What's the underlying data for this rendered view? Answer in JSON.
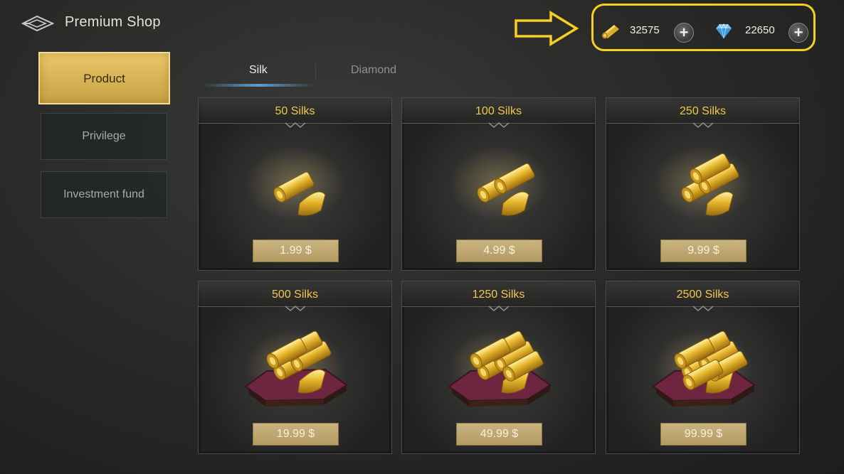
{
  "header": {
    "title": "Premium Shop"
  },
  "currencies": [
    {
      "icon": "silk-roll-icon",
      "value": "32575"
    },
    {
      "icon": "diamond-icon",
      "value": "22650"
    }
  ],
  "nav": {
    "items": [
      {
        "label": "Product",
        "active": true
      },
      {
        "label": "Privilege",
        "active": false
      },
      {
        "label": "Investment fund",
        "active": false
      }
    ]
  },
  "tabs": [
    {
      "label": "Silk",
      "active": true
    },
    {
      "label": "Diamond",
      "active": false
    }
  ],
  "products": [
    {
      "title": "50 Silks",
      "price": "1.99 $",
      "rolls": 1,
      "tray": false
    },
    {
      "title": "100 Silks",
      "price": "4.99 $",
      "rolls": 2,
      "tray": false
    },
    {
      "title": "250 Silks",
      "price": "9.99 $",
      "rolls": 3,
      "tray": false
    },
    {
      "title": "500 Silks",
      "price": "19.99 $",
      "rolls": 4,
      "tray": true
    },
    {
      "title": "1250 Silks",
      "price": "49.99 $",
      "rolls": 5,
      "tray": true
    },
    {
      "title": "2500 Silks",
      "price": "99.99 $",
      "rolls": 6,
      "tray": true
    }
  ],
  "colors": {
    "accent_gold": "#f0c94a",
    "highlight_outline": "#f5d020",
    "active_tab": "#5d9ed0"
  }
}
